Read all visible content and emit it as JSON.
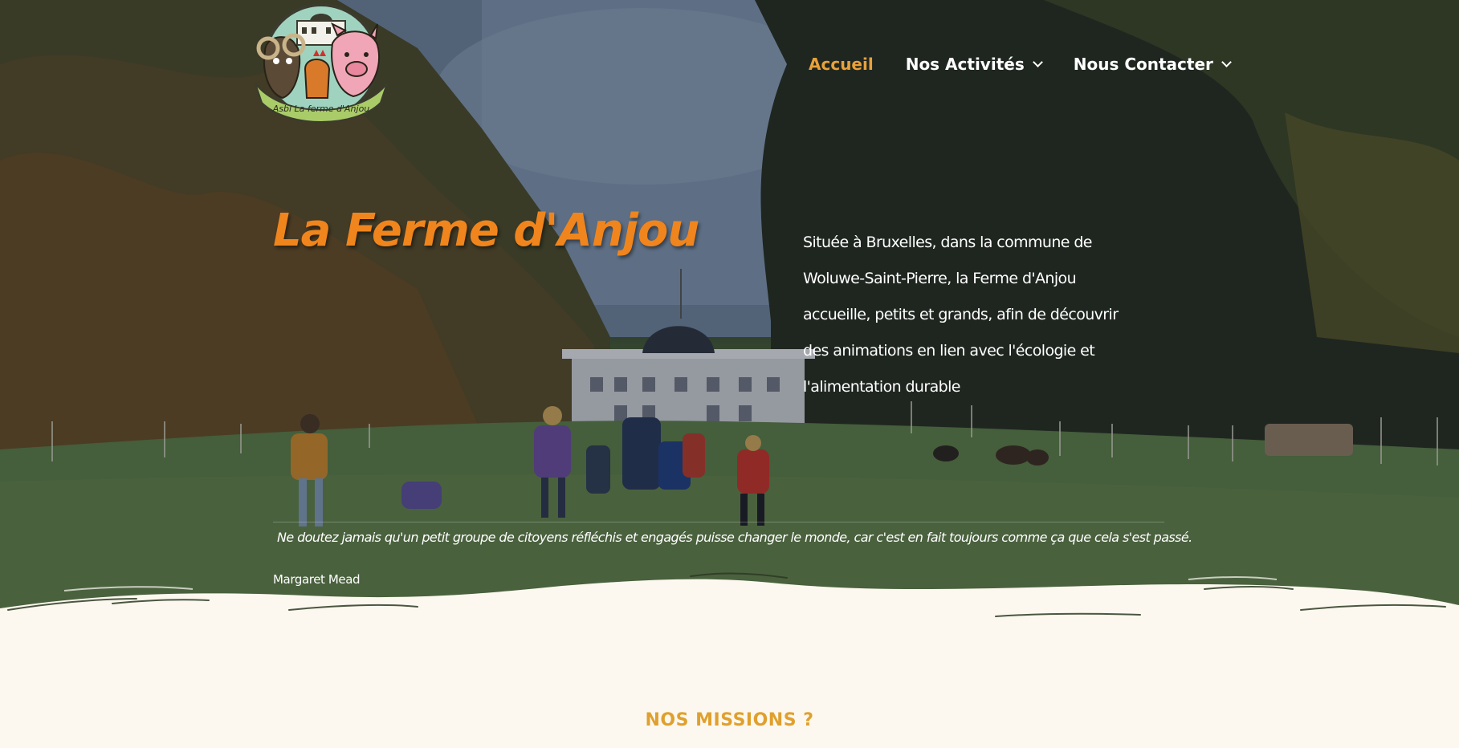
{
  "logo": {
    "text": "Asbl La ferme d'Anjou"
  },
  "nav": {
    "items": [
      {
        "label": "Accueil",
        "active": true,
        "dropdown": false
      },
      {
        "label": "Nos Activités",
        "active": false,
        "dropdown": true
      },
      {
        "label": "Nous Contacter",
        "active": false,
        "dropdown": true
      }
    ]
  },
  "hero": {
    "title": "La Ferme d'Anjou",
    "intro": "Située à Bruxelles, dans la commune de Woluwe-Saint-Pierre, la Ferme d'Anjou accueille, petits et grands, afin de découvrir des animations en lien avec l'écologie et l'alimentation durable",
    "quote": "Ne doutez jamais qu'un petit groupe de citoyens réfléchis et engagés puisse changer le monde, car c'est en fait toujours comme ça que cela s'est passé.",
    "author": "Margaret Mead"
  },
  "section": {
    "heading": "NOS MISSIONS ?"
  },
  "colors": {
    "accent": "#f0851d",
    "nav_active": "#e8a13a",
    "page_bg": "#fcf8ef",
    "heading": "#e0a02e"
  }
}
